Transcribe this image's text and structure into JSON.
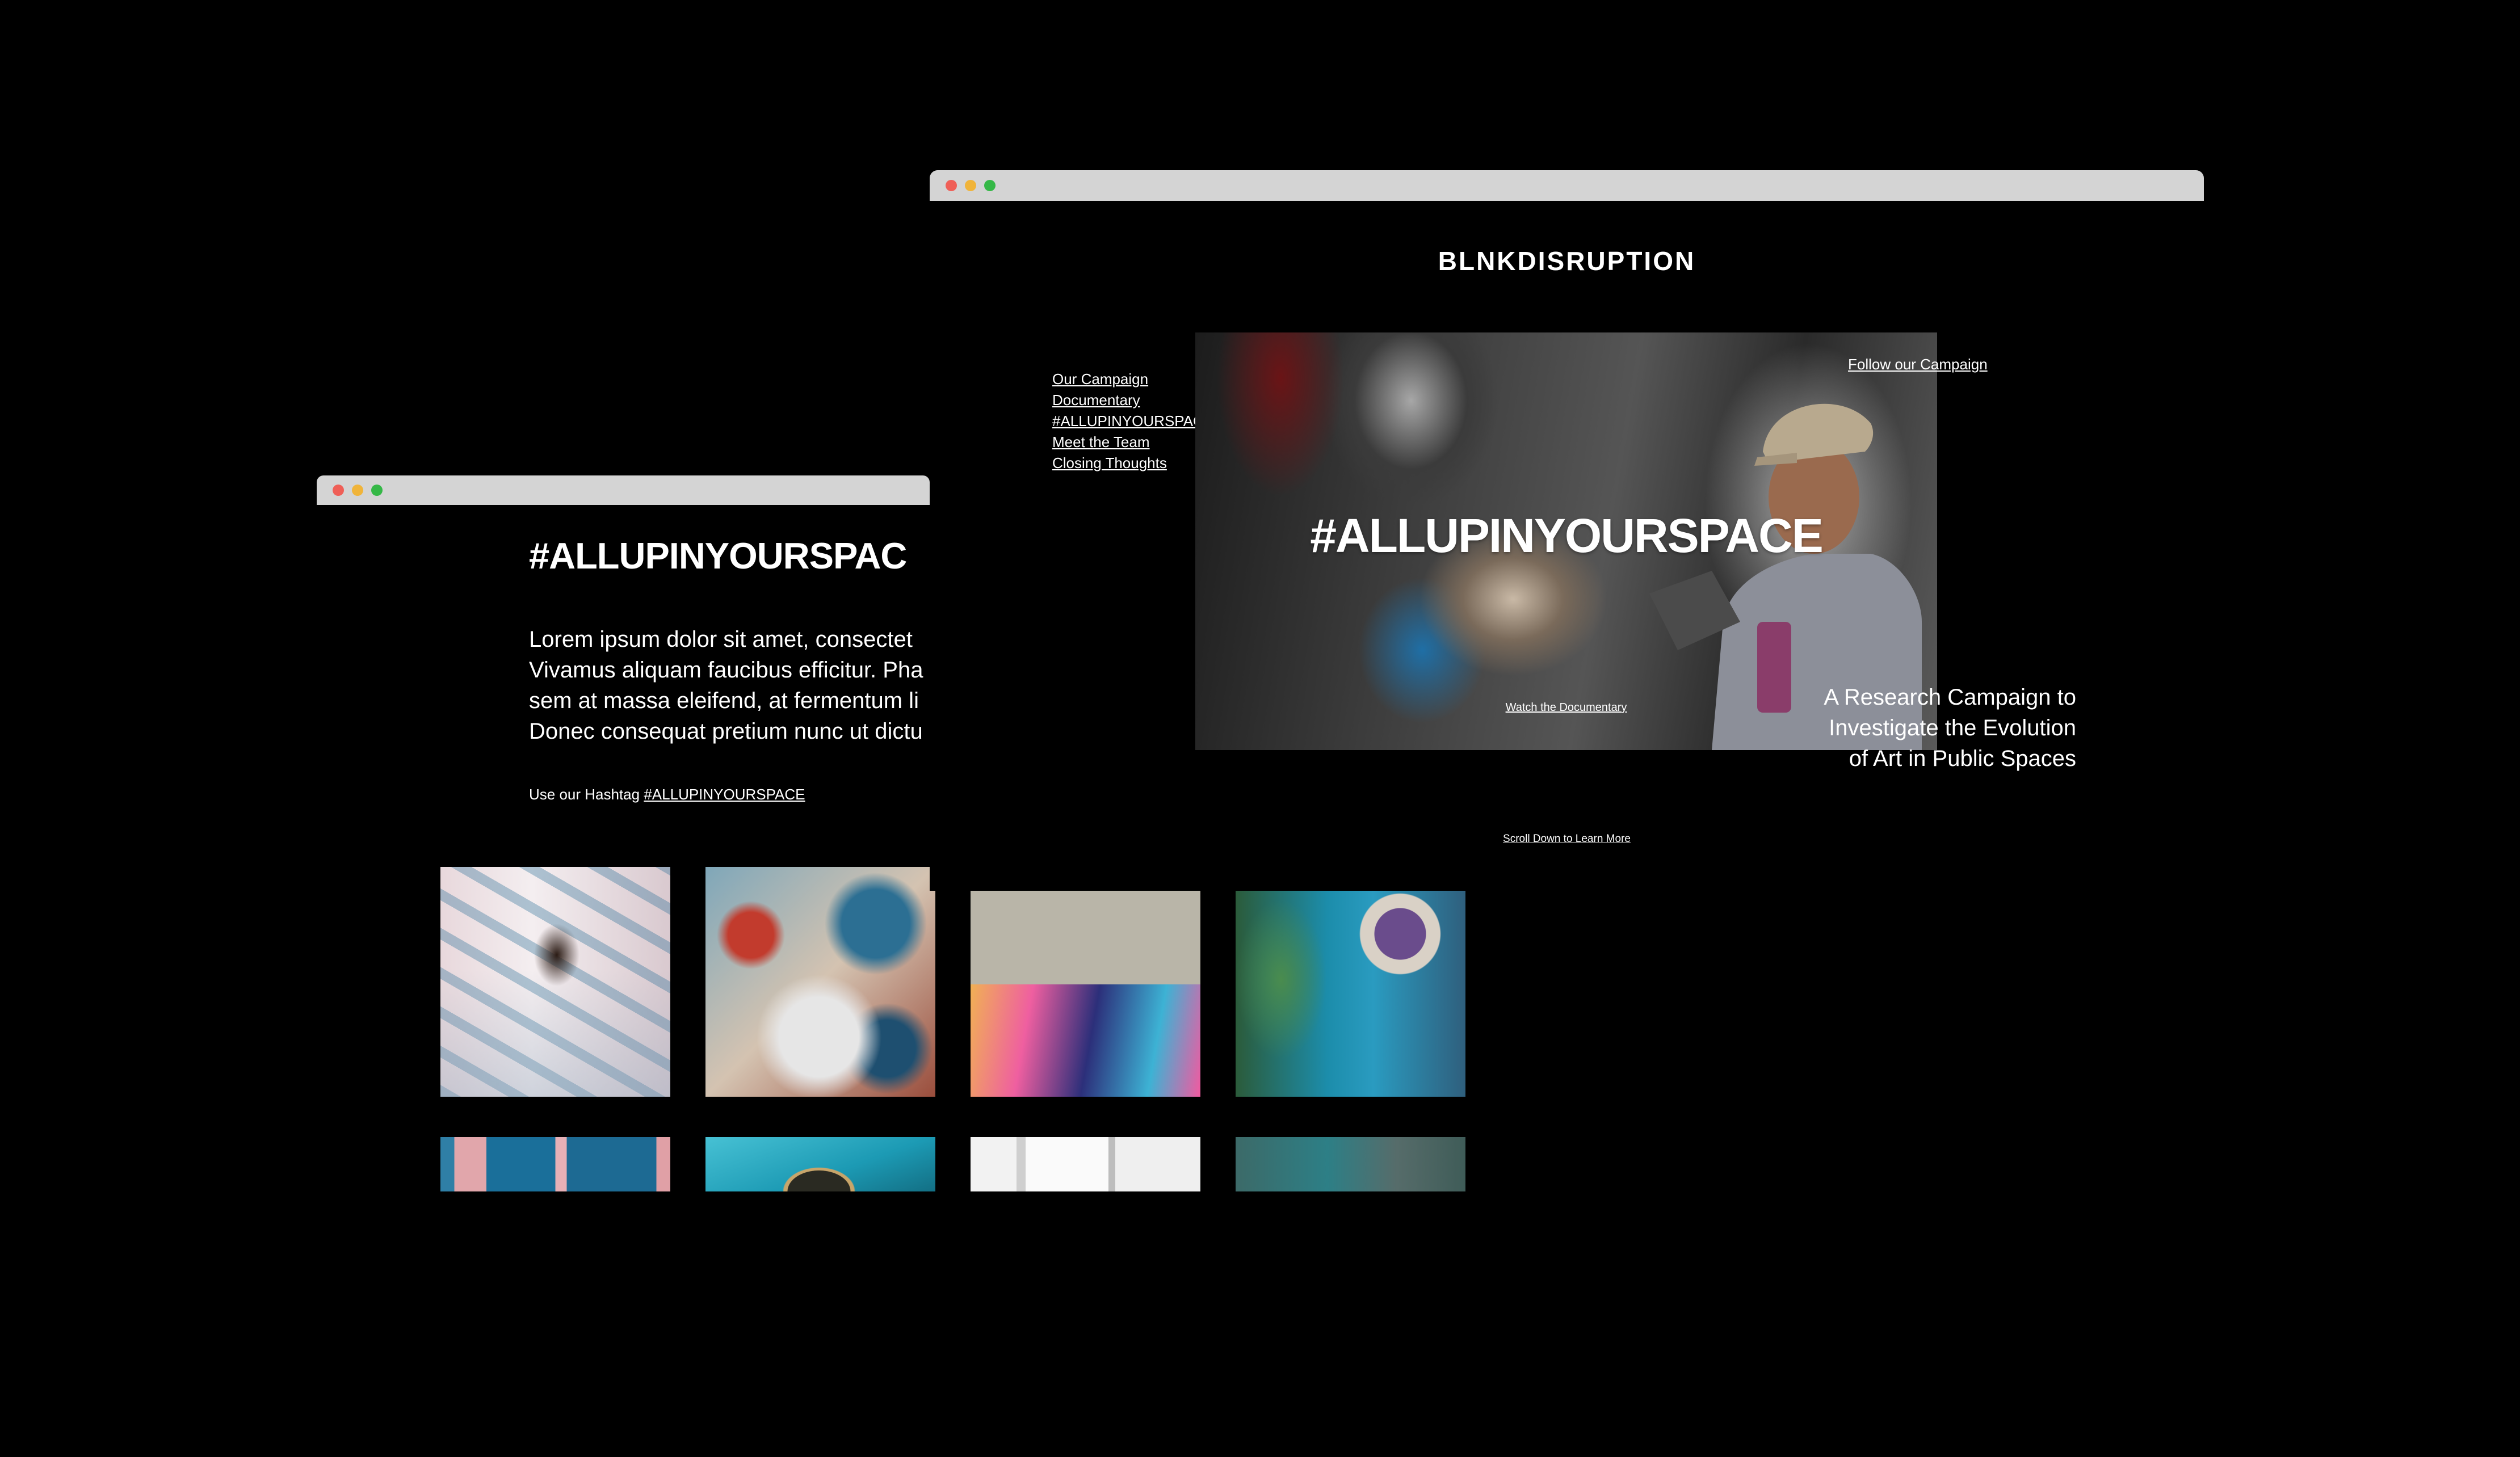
{
  "back_window": {
    "hashtag_title": "#ALLUPINYOURSPAC",
    "body_lines": [
      "Lorem ipsum dolor sit amet, consectet",
      "Vivamus aliquam faucibus efficitur. Pha",
      "sem at massa eleifend, at fermentum li",
      "Donec consequat pretium nunc ut dictu"
    ],
    "cta_prefix": "Use our Hashtag",
    "cta_link": "#ALLUPINYOURSPACE"
  },
  "front_window": {
    "brand": "BLNKDISRUPTION",
    "nav": [
      "Our Campaign",
      "Documentary",
      "#ALLUPINYOURSPACE",
      "Meet the Team",
      "Closing Thoughts"
    ],
    "follow_link": "Follow our Campaign",
    "hero_title": "#ALLUPINYOURSPACE",
    "watch_link": "Watch the Documentary",
    "tagline_lines": [
      "A Research Campaign to",
      "Investigate the Evolution",
      "of Art in Public Spaces"
    ],
    "scroll_link": "Scroll Down to Learn More"
  },
  "colors": {
    "background": "#000000",
    "titlebar": "#d4d4d4",
    "dot_red": "#ef5f57",
    "dot_yellow": "#f0b43a",
    "dot_green": "#35b847"
  }
}
